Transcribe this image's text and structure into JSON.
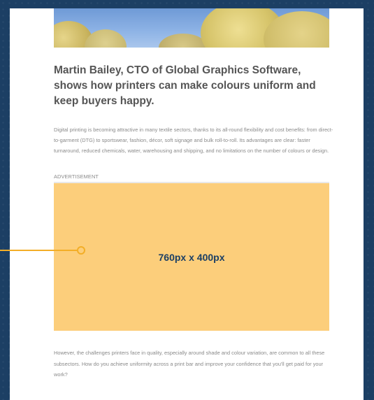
{
  "article": {
    "headline": "Martin Bailey, CTO of Global Graphics Software, shows how printers can make colours uniform and keep buyers happy.",
    "intro": "Digital printing is becoming attractive in many textile sectors, thanks to its all-round flexibility and cost benefits: from direct-to-garment (DTG) to sportswear, fashion, décor, soft signage and bulk roll-to-roll. Its advantages are clear: faster turnaround, reduced chemicals, water, warehousing and shipping, and no limitations on the number of colours or design.",
    "outro": "However, the challenges printers face in quality, especially around shade and colour variation, are common to all these subsectors. How do you achieve uniformity across a print bar and improve your confidence that you'll get paid for your work?"
  },
  "ad": {
    "label": "ADVERTISEMENT",
    "size_text": "760px x 400px"
  },
  "colors": {
    "background": "#1c3f64",
    "ad_fill": "#fcce7b",
    "pointer": "#f3ae27"
  }
}
